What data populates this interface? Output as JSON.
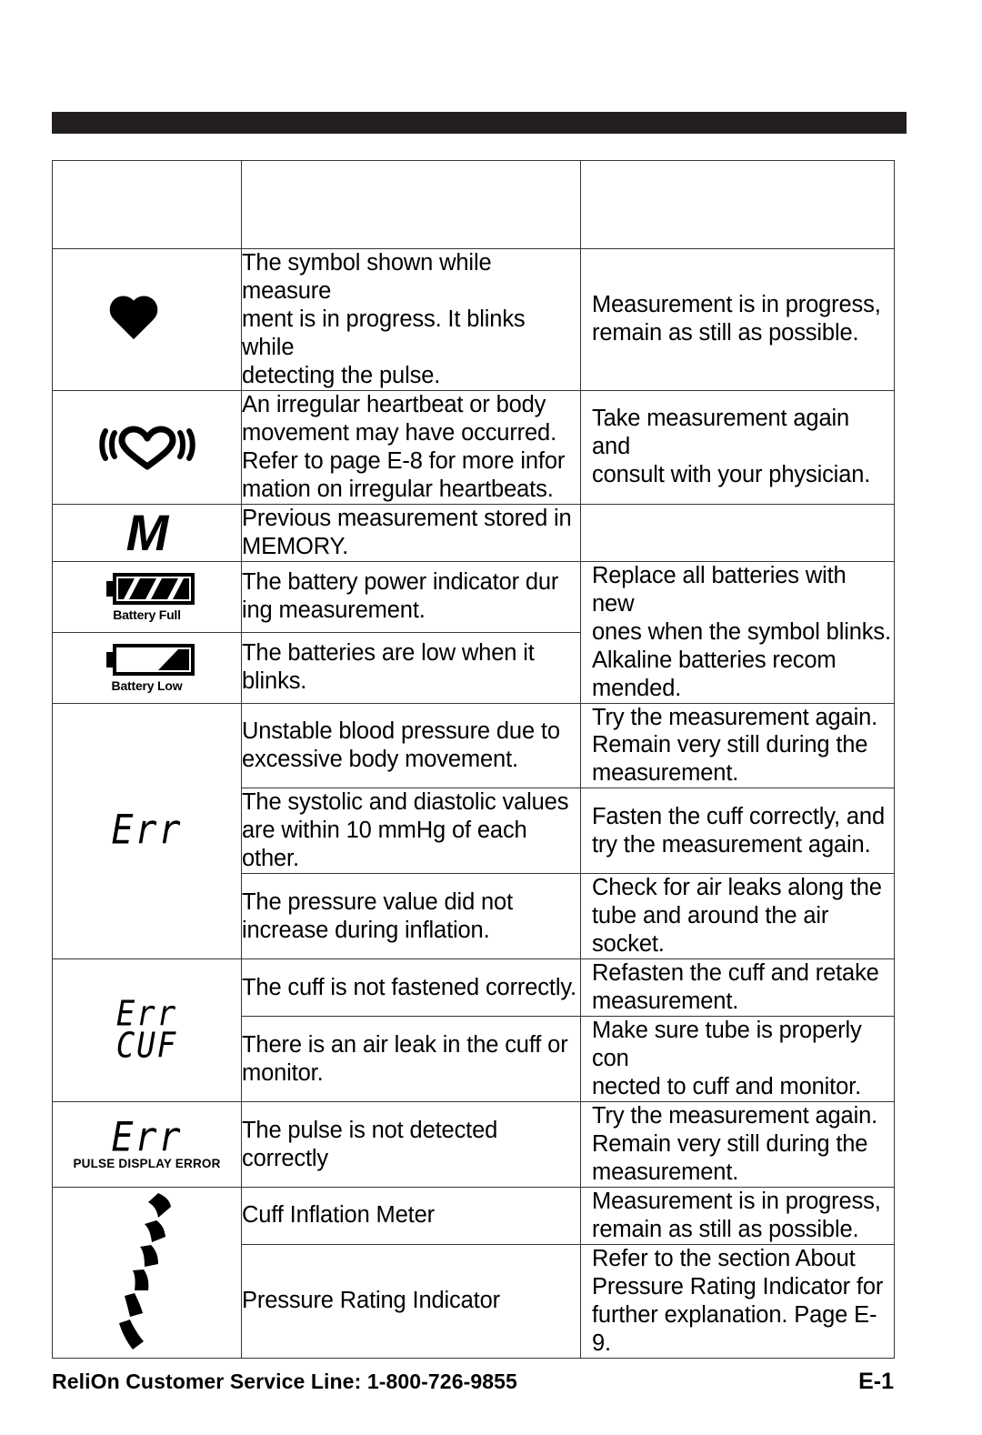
{
  "page": {
    "footer_left": "ReliOn  Customer Service Line: 1-800-726-9855",
    "footer_right": "E-1"
  },
  "table": {
    "header": {
      "symbol": "",
      "description": "",
      "action": ""
    },
    "rows": [
      {
        "symbol_name": "heart-solid-icon",
        "symbol_caption": "",
        "description": "The symbol shown while measure\nment is in progress. It blinks while\ndetecting the pulse.",
        "action": "Measurement is in progress,\nremain as still as possible."
      },
      {
        "symbol_name": "irregular-heartbeat-icon",
        "symbol_caption": "",
        "description": "An irregular heartbeat or body\nmovement may have occurred.\nRefer to page E-8 for more infor\nmation on irregular heartbeats.",
        "action": "Take measurement again and\nconsult with your physician."
      },
      {
        "symbol_name": "memory-m-icon",
        "symbol_caption": "",
        "description": "Previous measurement stored in\nMEMORY.",
        "action": ""
      },
      {
        "symbol_name": "battery-full-icon",
        "symbol_caption": "Battery Full",
        "description": "The battery power indicator dur\ning measurement.",
        "action": "Replace all batteries with new\nones when the symbol blinks.\nAlkaline batteries recom\nmended."
      },
      {
        "symbol_name": "battery-low-icon",
        "symbol_caption": "Battery Low",
        "description": "The batteries are low when it\nblinks.",
        "action": ""
      },
      {
        "symbol_name": "err-lcd-icon",
        "symbol_caption": "",
        "symbol_text": "Err",
        "description": "Unstable blood pressure due to\nexcessive body movement.",
        "action": "Try the measurement again.\nRemain very still during the\nmeasurement."
      },
      {
        "description": "The systolic and diastolic values\nare within 10 mmHg of  each\nother.",
        "action": "Fasten the cuff  correctly, and\ntry the measurement again."
      },
      {
        "description": "The pressure value did not\nincrease during inflation.",
        "action": "Check for air leaks along the\ntube and around the air socket."
      },
      {
        "symbol_name": "err-cuf-lcd-icon",
        "symbol_text_line1": "Err",
        "symbol_text_line2": "CUF",
        "description": "The cuff  is not fastened correctly.",
        "action": "Refasten the cuff  and retake\nmeasurement."
      },
      {
        "description": "There is an air leak in the cuff  or\nmonitor.",
        "action": "Make sure tube is properly con\nnected to cuff  and monitor."
      },
      {
        "symbol_name": "err-pulse-display-icon",
        "symbol_text": "Err",
        "symbol_caption": "PULSE DISPLAY ERROR",
        "description": "The pulse is not detected correctly",
        "action": "Try the measurement again.\nRemain very still during the\nmeasurement."
      },
      {
        "symbol_name": "cuff-inflation-arc-icon",
        "description": "Cuff  Inflation Meter",
        "action": "Measurement is in progress,\nremain as still as possible."
      },
      {
        "description": "Pressure Rating Indicator",
        "action": "Refer to the section  About\nPressure Rating Indicator  for\nfurther explanation. Page E-9."
      }
    ]
  },
  "colors": {
    "header_bar": "#231f20",
    "border": "#3a3237",
    "text": "#000000",
    "background": "#ffffff"
  }
}
